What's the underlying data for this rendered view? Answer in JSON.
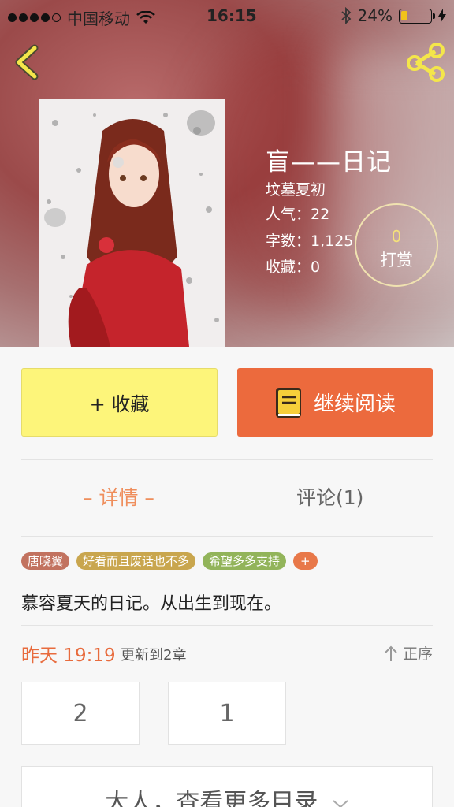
{
  "status_bar": {
    "carrier": "中国移动",
    "time": "16:15",
    "battery_pct": "24%",
    "battery_level": 0.24
  },
  "book": {
    "title": "盲——日记",
    "author": "坟墓夏初",
    "popularity": "人气：22",
    "word_count": "字数：1,125",
    "favorites": "收藏：0"
  },
  "tip": {
    "count": "0",
    "label": "打赏"
  },
  "actions": {
    "favorite_label": "+ 收藏",
    "read_label": "继续阅读"
  },
  "tabs": [
    {
      "label": "– 详情 –",
      "active": true
    },
    {
      "label": "评论(1)",
      "active": false
    }
  ],
  "tags": [
    {
      "label": "唐晓翼",
      "color": "#c2725f"
    },
    {
      "label": "好看而且废话也不多",
      "color": "#c9a64e"
    },
    {
      "label": "希望多多支持",
      "color": "#92b45a"
    },
    {
      "label": "+",
      "color": "#e87849"
    }
  ],
  "summary": "慕容夏天的日记。从出生到现在。",
  "update": {
    "time": "昨天 19:19",
    "text": "更新到2章",
    "order_label": "正序"
  },
  "chapters": [
    "2",
    "1"
  ],
  "more_label": "大人，查看更多目录",
  "colors": {
    "accent": "#ec6a3d",
    "favorite": "#fdf57a",
    "back_icon": "#f4e64a"
  }
}
